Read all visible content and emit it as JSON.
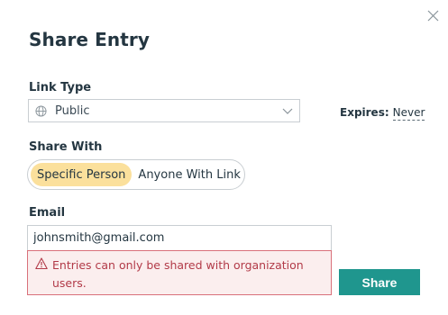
{
  "dialog": {
    "title": "Share Entry",
    "close_icon": "close-icon"
  },
  "link_type": {
    "label": "Link Type",
    "selected": "Public",
    "icon": "globe-icon"
  },
  "expires": {
    "label": "Expires:",
    "value": "Never"
  },
  "share_with": {
    "label": "Share With",
    "options": [
      "Specific Person",
      "Anyone With Link"
    ],
    "selected": "Specific Person"
  },
  "email": {
    "label": "Email",
    "value": "johnsmith@gmail.com"
  },
  "error": {
    "message": "Entries can only be shared with organization users."
  },
  "actions": {
    "share_label": "Share"
  },
  "colors": {
    "primary": "#1f968e",
    "toggle_active": "#fbe09c",
    "error_text": "#b23a48",
    "error_border": "#d9707a",
    "error_bg": "#fbeeee"
  }
}
